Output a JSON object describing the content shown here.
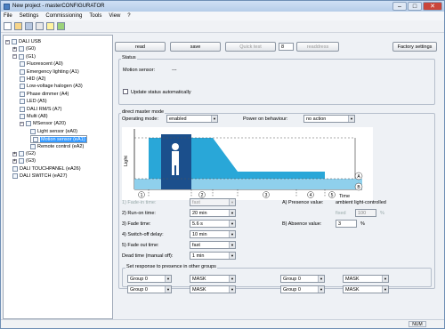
{
  "window": {
    "title": "New project - masterCONFIGURATOR",
    "min_label": "–",
    "max_label": "□",
    "close_label": "✕"
  },
  "menu": [
    "File",
    "Settings",
    "Commissioning",
    "Tools",
    "View",
    "?"
  ],
  "tree": {
    "items": [
      {
        "label": "DALI USB",
        "level": 0,
        "expander": "−",
        "icon": "usb-icon"
      },
      {
        "label": "(G0)",
        "level": 1,
        "expander": "+",
        "icon": "group-icon"
      },
      {
        "label": "(G1)",
        "level": 1,
        "expander": "−",
        "icon": "group-icon"
      },
      {
        "label": "Fluorescent (A0)",
        "level": 2,
        "expander": "",
        "icon": "lamp-icon"
      },
      {
        "label": "Emergency lighting (A1)",
        "level": 2,
        "expander": "",
        "icon": "lamp-icon"
      },
      {
        "label": "HID (A2)",
        "level": 2,
        "expander": "",
        "icon": "lamp-icon"
      },
      {
        "label": "Low-voltage halogen (A3)",
        "level": 2,
        "expander": "",
        "icon": "lamp-icon"
      },
      {
        "label": "Phase dimmer (A4)",
        "level": 2,
        "expander": "",
        "icon": "lamp-icon"
      },
      {
        "label": "LED (A5)",
        "level": 2,
        "expander": "",
        "icon": "lamp-icon"
      },
      {
        "label": "DALI RM/S (A7)",
        "level": 2,
        "expander": "",
        "icon": "lamp-icon"
      },
      {
        "label": "Multi (A8)",
        "level": 2,
        "expander": "",
        "icon": "lamp-icon"
      },
      {
        "label": "MSensor (A20)",
        "level": 2,
        "expander": "−",
        "icon": "sensor-icon"
      },
      {
        "label": "Light sensor (eA0)",
        "level": 3,
        "expander": "",
        "icon": "sensor-icon"
      },
      {
        "label": "Motion sensor (eA1)",
        "level": 3,
        "expander": "",
        "icon": "sensor-icon",
        "selected": true
      },
      {
        "label": "Remote control (eA2)",
        "level": 3,
        "expander": "",
        "icon": "remote-icon"
      },
      {
        "label": "(G2)",
        "level": 1,
        "expander": "+",
        "icon": "group-icon"
      },
      {
        "label": "(G3)",
        "level": 1,
        "expander": "+",
        "icon": "group-icon"
      },
      {
        "label": "DALI TOUCHPANEL (eA26)",
        "level": 1,
        "expander": "",
        "icon": "panel-icon"
      },
      {
        "label": "DALI SWITCH (eA27)",
        "level": 1,
        "expander": "",
        "icon": "switch-icon"
      }
    ]
  },
  "topbar": {
    "read": "read",
    "save": "save",
    "quick_test": "Quick test",
    "address_value": "8",
    "readdress": "readdress",
    "factory": "Factory settings"
  },
  "status": {
    "group_label": "Status",
    "motion_label": "Motion sensor:",
    "motion_value": "---",
    "auto_update_label": "Update status automatically"
  },
  "dmm": {
    "group_label": "direct master mode",
    "operating_label": "Operating mode:",
    "operating_value": "enabled",
    "power_label": "Power on behaviour:",
    "power_value": "no action",
    "graph": {
      "y_label": "Light",
      "x_label": "Time",
      "markers": [
        "1",
        "2",
        "3",
        "4",
        "5"
      ],
      "level_markers": [
        "A",
        "B"
      ]
    },
    "fade_in_label": "1) Fade-in time:",
    "fade_in_value": "fast",
    "run_on_label": "2) Run-on time:",
    "run_on_value": "20 min",
    "fade_label": "3) Fade time:",
    "fade_value": "5.6 s",
    "switch_off_label": "4) Switch-off delay:",
    "switch_off_value": "10 min",
    "fade_out_label": "5) Fade out time:",
    "fade_out_value": "fast",
    "dead_label": "Dead time (manual off):",
    "dead_value": "1 min",
    "presence_label": "A) Presence value:",
    "presence_value": "ambient light-controlled",
    "fixed_label": "fixed",
    "fixed_value": "100",
    "percent_1": "%",
    "absence_label": "B) Absence value:",
    "absence_value": "3",
    "percent_2": "%"
  },
  "groups_section": {
    "label": "Set response to presence in other groups",
    "rows": [
      {
        "g1": "Group 0",
        "m1": "MASK",
        "g2": "Group 0",
        "m2": "MASK"
      },
      {
        "g1": "Group 0",
        "m1": "MASK",
        "g2": "Group 0",
        "m2": "MASK"
      }
    ]
  },
  "statusbar": {
    "num": "NUM"
  },
  "colors": {
    "accent": "#3399ff",
    "graph_fill": "#29a7d8",
    "graph_light": "#8fd0ec",
    "figure": "#1b4f8c"
  }
}
